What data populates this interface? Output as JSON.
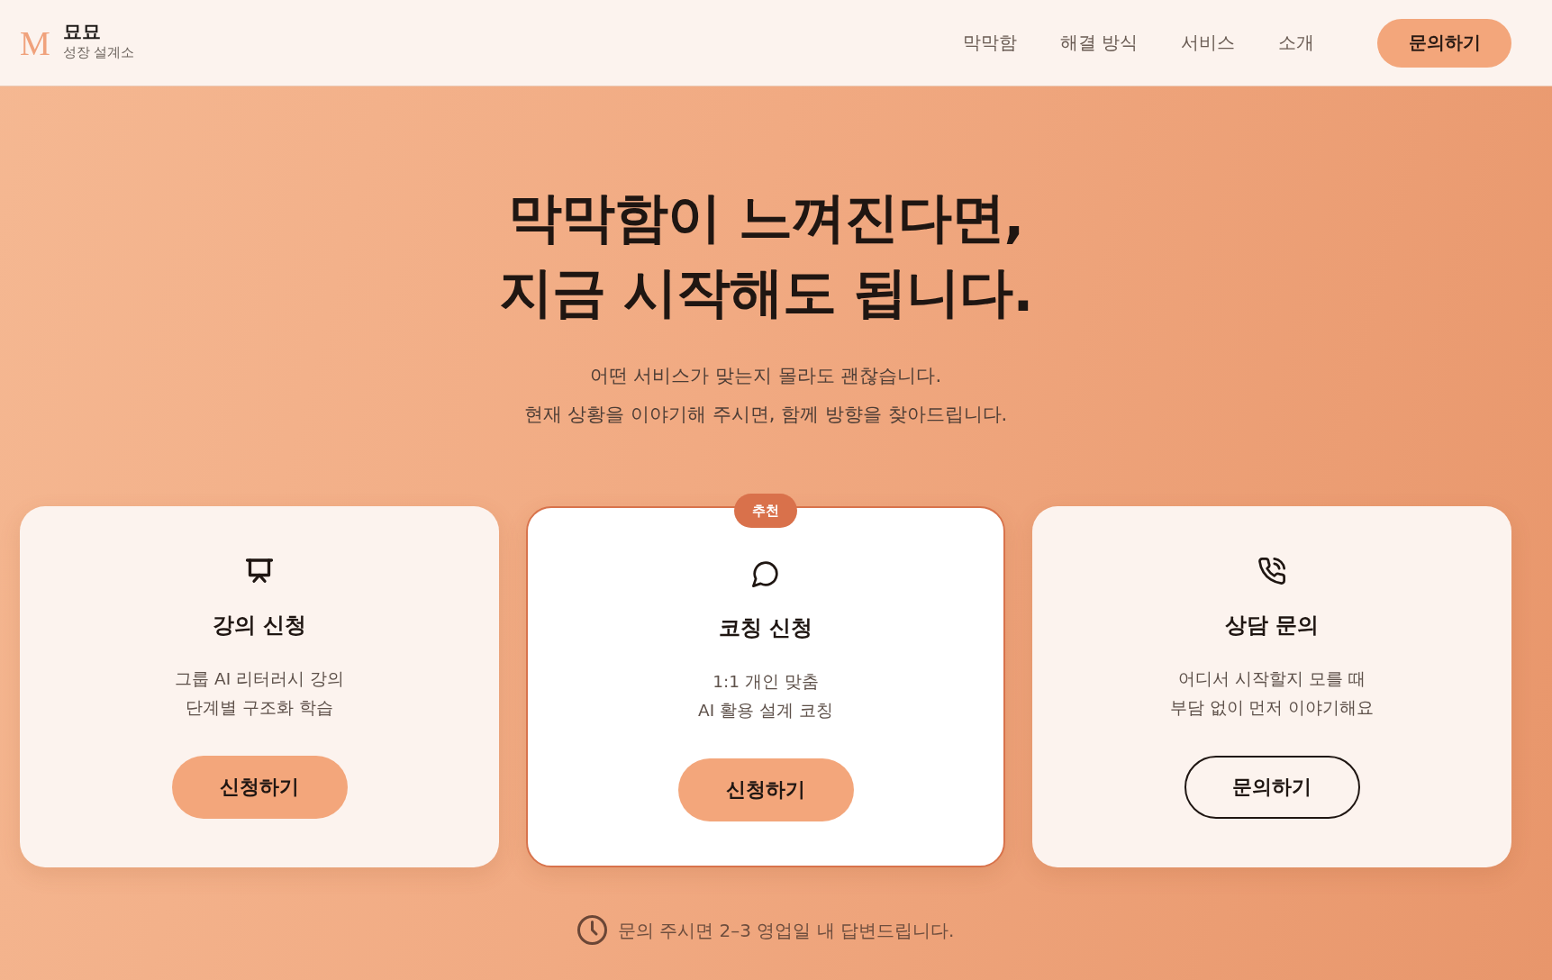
{
  "header": {
    "logo_mark": "M",
    "brand": "묘묘",
    "tagline": "성장 설계소",
    "nav": [
      "막막함",
      "해결 방식",
      "서비스",
      "소개"
    ],
    "cta": "문의하기"
  },
  "hero": {
    "heading": [
      "막막함이 느껴진다면,",
      "지금 시작해도 됩니다."
    ],
    "subtitle": [
      "어떤 서비스가 맞는지 몰라도 괜찮습니다.",
      "현재 상황을 이야기해 주시면, 함께 방향을 찾아드립니다."
    ]
  },
  "cards": [
    {
      "title": "강의 신청",
      "description": [
        "그룹 AI 리터러시 강의",
        "단계별 구조화 학습"
      ],
      "button": {
        "label": "신청하기",
        "kind": "filled"
      },
      "featured": false
    },
    {
      "badge": "추천",
      "title": "코칭 신청",
      "description": [
        "1:1 개인 맞춤",
        "AI 활용 설계 코칭"
      ],
      "button": {
        "label": "신청하기",
        "kind": "filled"
      },
      "featured": true
    },
    {
      "title": "상담 문의",
      "description": [
        "어디서 시작할지 모를 때",
        "부담 없이 먼저 이야기해요"
      ],
      "button": {
        "label": "문의하기",
        "kind": "outline"
      },
      "featured": false
    }
  ],
  "note": "문의 주시면 2–3 영업일 내 답변드립니다."
}
